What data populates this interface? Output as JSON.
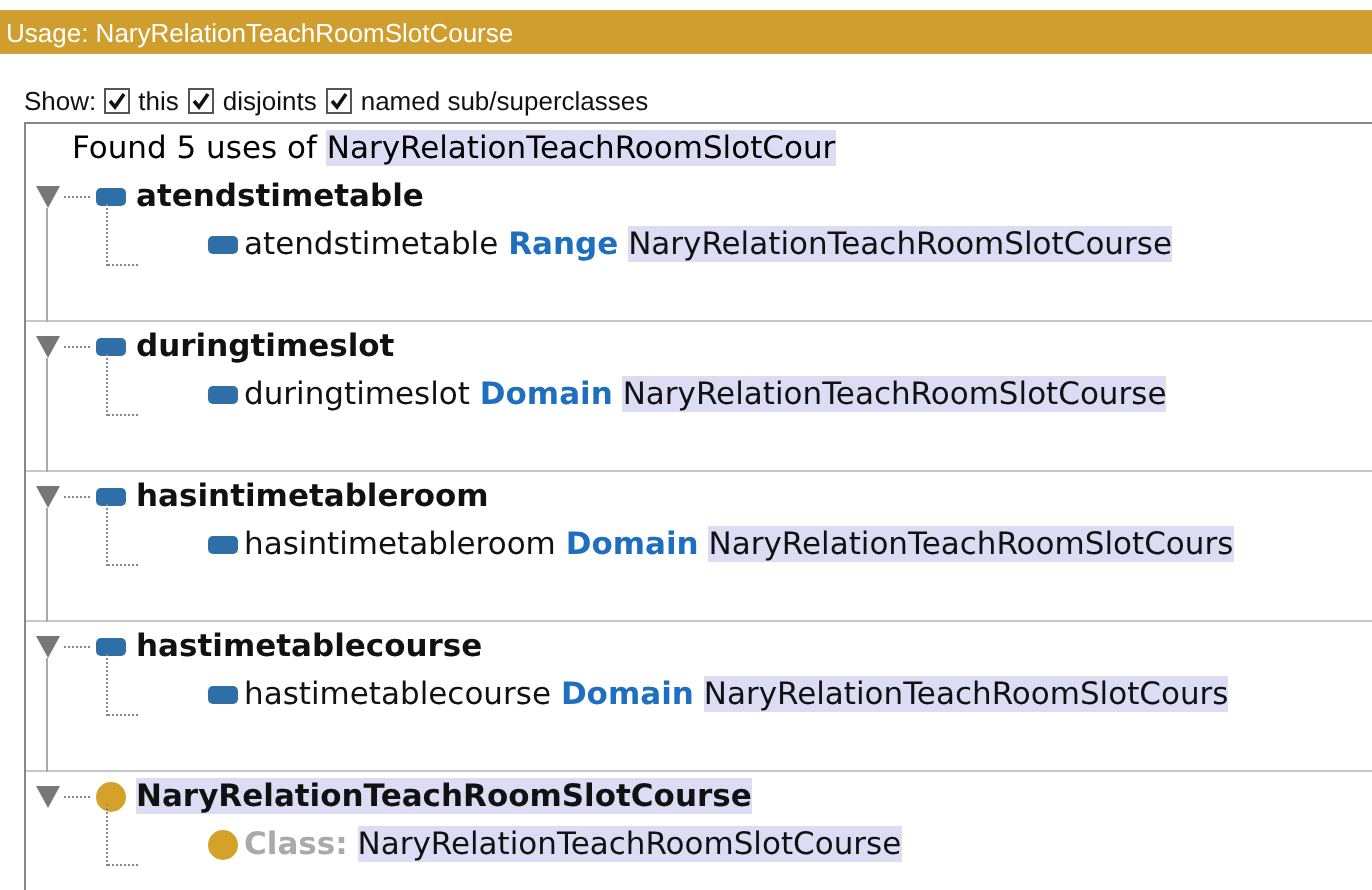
{
  "panel": {
    "title": "Usage: NaryRelationTeachRoomSlotCourse"
  },
  "show": {
    "label": "Show:",
    "options": [
      {
        "label": "this",
        "checked": true
      },
      {
        "label": "disjoints",
        "checked": true
      },
      {
        "label": "named sub/superclasses",
        "checked": true
      }
    ]
  },
  "found": {
    "text": "Found 5 uses of",
    "term": "NaryRelationTeachRoomSlotCour"
  },
  "groups": [
    {
      "kind": "property",
      "name": "atendstimetable",
      "expanded": true,
      "highlighted": false,
      "usage": {
        "subject": "atendstimetable",
        "keyword": "Range",
        "object": "NaryRelationTeachRoomSlotCourse"
      }
    },
    {
      "kind": "property",
      "name": "duringtimeslot",
      "expanded": true,
      "highlighted": false,
      "usage": {
        "subject": "duringtimeslot",
        "keyword": "Domain",
        "object": "NaryRelationTeachRoomSlotCourse"
      }
    },
    {
      "kind": "property",
      "name": "hasintimetableroom",
      "expanded": true,
      "highlighted": false,
      "usage": {
        "subject": "hasintimetableroom",
        "keyword": "Domain",
        "object": "NaryRelationTeachRoomSlotCours"
      }
    },
    {
      "kind": "property",
      "name": "hastimetablecourse",
      "expanded": true,
      "highlighted": false,
      "usage": {
        "subject": "hastimetablecourse",
        "keyword": "Domain",
        "object": "NaryRelationTeachRoomSlotCours"
      }
    },
    {
      "kind": "class",
      "name": "NaryRelationTeachRoomSlotCourse",
      "expanded": true,
      "highlighted": true,
      "usage": {
        "keyword": "Class:",
        "object": "NaryRelationTeachRoomSlotCourse"
      }
    }
  ]
}
